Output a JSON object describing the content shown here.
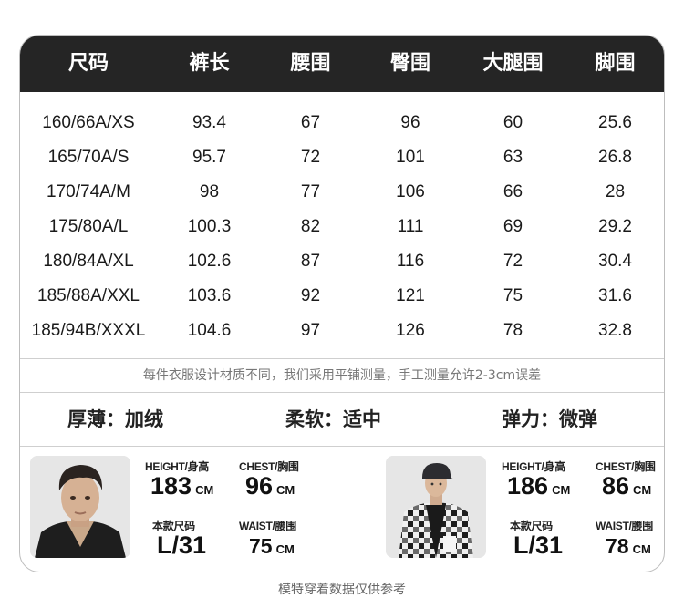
{
  "header": {
    "columns": [
      "尺码",
      "裤长",
      "腰围",
      "臀围",
      "大腿围",
      "脚围"
    ]
  },
  "rows": [
    [
      "160/66A/XS",
      "93.4",
      "67",
      "96",
      "60",
      "25.6"
    ],
    [
      "165/70A/S",
      "95.7",
      "72",
      "101",
      "63",
      "26.8"
    ],
    [
      "170/74A/M",
      "98",
      "77",
      "106",
      "66",
      "28"
    ],
    [
      "175/80A/L",
      "100.3",
      "82",
      "111",
      "69",
      "29.2"
    ],
    [
      "180/84A/XL",
      "102.6",
      "87",
      "116",
      "72",
      "30.4"
    ],
    [
      "185/88A/XXL",
      "103.6",
      "92",
      "121",
      "75",
      "31.6"
    ],
    [
      "185/94B/XXXL",
      "104.6",
      "97",
      "126",
      "78",
      "32.8"
    ]
  ],
  "note": "每件衣服设计材质不同，我们采用平铺测量，手工测量允许2-3cm误差",
  "properties": {
    "thickness": "厚薄：加绒",
    "softness": "柔软：适中",
    "elasticity": "弹力：微弹"
  },
  "models": [
    {
      "height_label": "HEIGHT/身高",
      "height": "183",
      "chest_label": "CHEST/胸围",
      "chest": "96",
      "size_label": "本款尺码",
      "size": "L/31",
      "waist_label": "WAIST/腰围",
      "waist": "75",
      "unit": "CM"
    },
    {
      "height_label": "HEIGHT/身高",
      "height": "186",
      "chest_label": "CHEST/胸围",
      "chest": "86",
      "size_label": "本款尺码",
      "size": "L/31",
      "waist_label": "WAIST/腰围",
      "waist": "78",
      "unit": "CM"
    }
  ],
  "footer": "模特穿着数据仅供参考"
}
